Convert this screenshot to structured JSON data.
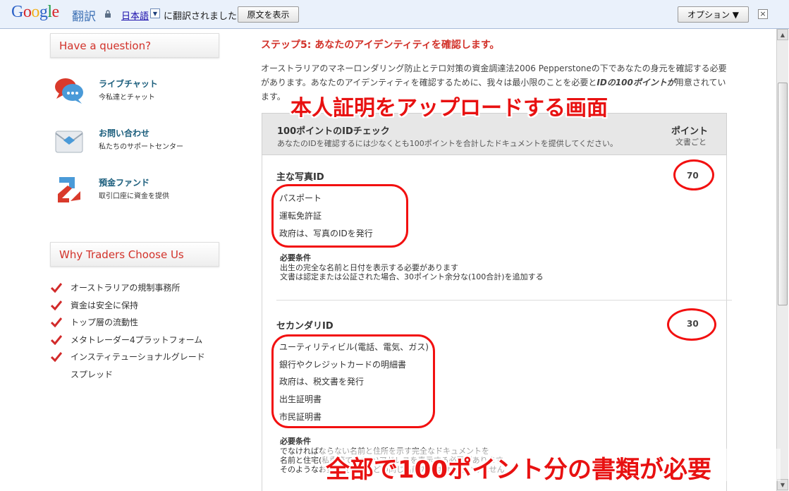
{
  "translate_bar": {
    "logo": "Google",
    "service": "翻訳",
    "language": "日本語",
    "translated_text": "に翻訳されました",
    "show_original_button": "原文を表示",
    "options_button": "オプション ▼",
    "close": "×"
  },
  "sidebar": {
    "have_question": "Have a question?",
    "services": [
      {
        "title": "ライブチャット",
        "subtitle": "今私達とチャット",
        "icon": "chat-bubbles-icon"
      },
      {
        "title": "お問い合わせ",
        "subtitle": "私たちのサポートセンター",
        "icon": "envelope-icon"
      },
      {
        "title": "預金ファンド",
        "subtitle": "取引口座に資金を提供",
        "icon": "transfer-arrows-icon"
      }
    ],
    "why_title": "Why Traders Choose Us",
    "why_items": [
      "オーストラリアの規制事務所",
      "資金は安全に保持",
      "トップ層の流動性",
      "メタトレーダー4プラットフォーム",
      "インスティテューショナルグレードスプレッド"
    ]
  },
  "main": {
    "step_title": "ステップ5: あなたのアイデンティティを確認します。",
    "intro_part1": "オーストラリアのマネーロンダリング防止とテロ対策の資金調達法2006 Pepperstoneの下であなたの身元を確認する必要があります。あなたのアイデンティティを確認するために、我々は最小限のことを必要と",
    "intro_bold": "IDの100ポイントが",
    "intro_part2": "用意されています。",
    "table_header": {
      "title": "100ポイントのIDチェック",
      "subtitle": "あなたのIDを確認するには少なくとも100ポイントを合計したドキュメントを提供してください。",
      "points_label": "ポイント",
      "per_doc": "文書ごと"
    },
    "primary": {
      "title": "主な写真ID",
      "points": "70",
      "docs": [
        "パスポート",
        "運転免許証",
        "政府は、写真のIDを発行"
      ],
      "req_title": "必要条件",
      "req_lines": [
        "出生の完全な名前と日付を表示する必要があります",
        "文書は認定または公証された場合、30ポイント余分な(100合計)を追加する"
      ]
    },
    "secondary": {
      "title": "セカンダリID",
      "points": "30",
      "docs": [
        "ユーティリティビル(電話、電気、ガス)",
        "銀行やクレジットカードの明細書",
        "政府は、税文書を発行",
        "出生証明書",
        "市民証明書"
      ],
      "req_title": "必要条件",
      "req_lines": [
        "でなければならない名前と住所を示す完全なドキュメントを",
        "名前と住宅(私書箱ではない)アドレスを表示する必要があります",
        "そのようなお金を受けたなどの同じ名前のではければいけません"
      ]
    }
  },
  "annotations": {
    "top_text": "本人証明をアップロードする画面",
    "bottom_text": "全部で100ポイント分の書類が必要",
    "color": "#e81111"
  }
}
